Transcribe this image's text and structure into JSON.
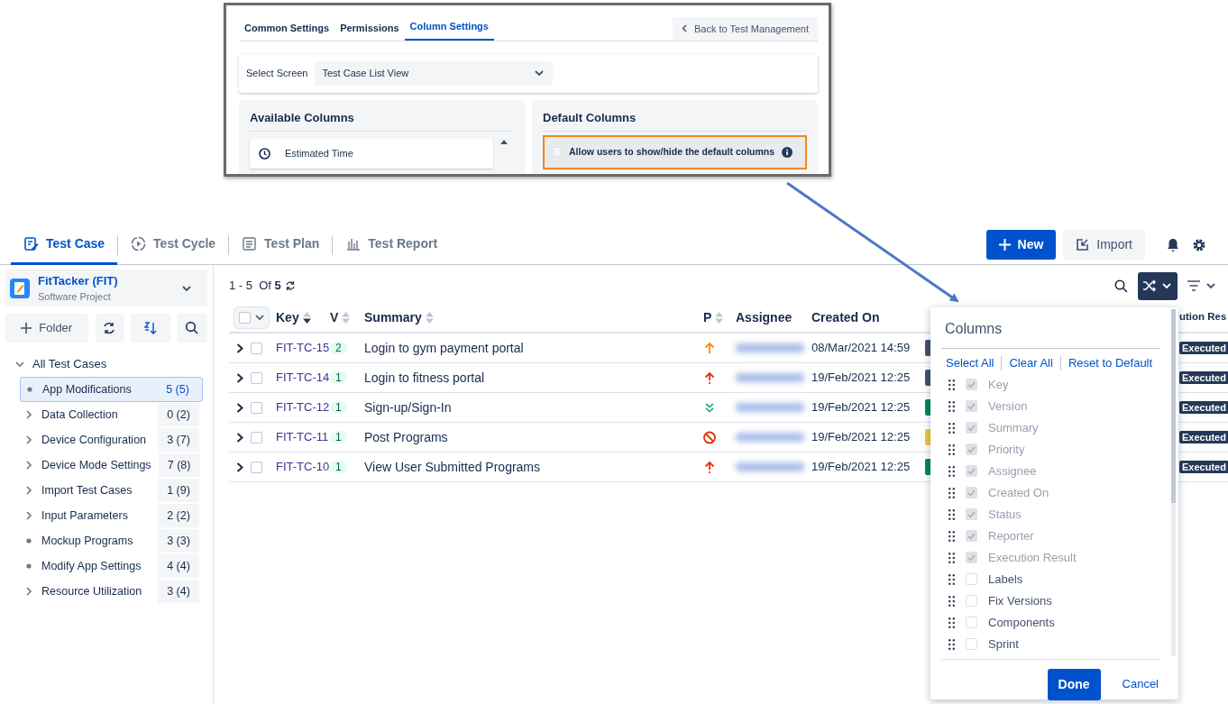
{
  "inset": {
    "tabs": [
      {
        "label": "Common Settings",
        "selected": false
      },
      {
        "label": "Permissions",
        "selected": false
      },
      {
        "label": "Column Settings",
        "selected": true
      }
    ],
    "back_button": "Back to Test Management",
    "select_screen": {
      "label": "Select Screen",
      "value": "Test Case List View"
    },
    "available_columns": {
      "title": "Available Columns",
      "items": [
        "Estimated Time"
      ]
    },
    "default_columns": {
      "title": "Default Columns",
      "option": {
        "label": "Allow users to show/hide the default columns",
        "checked": false,
        "highlighted": true
      }
    }
  },
  "nav_tabs": [
    {
      "label": "Test Case",
      "kind": "case",
      "selected": true
    },
    {
      "label": "Test Cycle",
      "kind": "cycle",
      "selected": false
    },
    {
      "label": "Test Plan",
      "kind": "plan",
      "selected": false
    },
    {
      "label": "Test Report",
      "kind": "report",
      "selected": false
    }
  ],
  "actions": {
    "new": "New",
    "import": "Import"
  },
  "project": {
    "name": "FitTacker (FIT)",
    "type": "Software Project"
  },
  "sidebar": {
    "folder_button": "Folder",
    "tree": {
      "label": "All Test Cases",
      "expanded": true,
      "children": [
        {
          "label": "App Modifications",
          "count": "5 (5)",
          "expandable": false,
          "selected": true
        },
        {
          "label": "Data Collection",
          "count": "0 (2)",
          "expandable": true,
          "selected": false
        },
        {
          "label": "Device Configuration",
          "count": "3 (7)",
          "expandable": true,
          "selected": false
        },
        {
          "label": "Device Mode Settings",
          "count": "7 (8)",
          "expandable": true,
          "selected": false
        },
        {
          "label": "Import Test Cases",
          "count": "1 (9)",
          "expandable": true,
          "selected": false
        },
        {
          "label": "Input Parameters",
          "count": "2 (2)",
          "expandable": true,
          "selected": false
        },
        {
          "label": "Mockup Programs",
          "count": "3 (3)",
          "expandable": false,
          "selected": false
        },
        {
          "label": "Modify App Settings",
          "count": "4 (4)",
          "expandable": false,
          "selected": false
        },
        {
          "label": "Resource Utilization",
          "count": "3 (4)",
          "expandable": true,
          "selected": false
        }
      ]
    }
  },
  "pagination": {
    "range": "1 - 5",
    "of": "Of",
    "total": "5"
  },
  "table": {
    "columns": [
      {
        "label": "Key",
        "sorted": true
      },
      {
        "label": "V",
        "sorted": false
      },
      {
        "label": "Summary",
        "sorted": false
      },
      {
        "label": "P",
        "sorted": false
      },
      {
        "label": "Assignee"
      },
      {
        "label": "Created On"
      },
      {
        "label": "ution Res"
      }
    ],
    "rows": [
      {
        "key": "FIT-TC-15",
        "checked": false,
        "version": "2",
        "summary": "Login to gym payment portal",
        "priority": {
          "kind": "high"
        },
        "created": "08/Mar/2021 14:59",
        "color": "#42526e",
        "result": "Executed"
      },
      {
        "key": "FIT-TC-14",
        "checked": false,
        "version": "1",
        "summary": "Login to fitness portal",
        "priority": {
          "kind": "highest"
        },
        "created": "19/Feb/2021 12:25",
        "color": "#42526e",
        "result": "Executed"
      },
      {
        "key": "FIT-TC-12",
        "checked": false,
        "version": "1",
        "summary": "Sign-up/Sign-In",
        "priority": {
          "kind": "lowest"
        },
        "created": "19/Feb/2021 12:25",
        "color": "#00875a",
        "result": "Executed"
      },
      {
        "key": "FIT-TC-11",
        "checked": false,
        "version": "1",
        "summary": "Post Programs",
        "priority": {
          "kind": "blocker"
        },
        "created": "19/Feb/2021 12:25",
        "color": "#f6c342",
        "result": "Executed"
      },
      {
        "key": "FIT-TC-10",
        "checked": false,
        "version": "1",
        "summary": "View User Submitted Programs",
        "priority": {
          "kind": "highest"
        },
        "created": "19/Feb/2021 12:25",
        "color": "#00875a",
        "result": "Executed"
      }
    ]
  },
  "columns_popup": {
    "title": "Columns",
    "links": [
      "Select All",
      "Clear All",
      "Reset to Default"
    ],
    "items": [
      {
        "label": "Key",
        "checked": true,
        "disabled": true
      },
      {
        "label": "Version",
        "checked": true,
        "disabled": true
      },
      {
        "label": "Summary",
        "checked": true,
        "disabled": true
      },
      {
        "label": "Priority",
        "checked": true,
        "disabled": true
      },
      {
        "label": "Assignee",
        "checked": true,
        "disabled": true
      },
      {
        "label": "Created On",
        "checked": true,
        "disabled": true
      },
      {
        "label": "Status",
        "checked": true,
        "disabled": true
      },
      {
        "label": "Reporter",
        "checked": true,
        "disabled": true
      },
      {
        "label": "Execution Result",
        "checked": true,
        "disabled": true
      },
      {
        "label": "Labels",
        "checked": false,
        "disabled": false
      },
      {
        "label": "Fix Versions",
        "checked": false,
        "disabled": false
      },
      {
        "label": "Components",
        "checked": false,
        "disabled": false
      },
      {
        "label": "Sprint",
        "checked": false,
        "disabled": false
      }
    ],
    "done": "Done",
    "cancel": "Cancel"
  }
}
